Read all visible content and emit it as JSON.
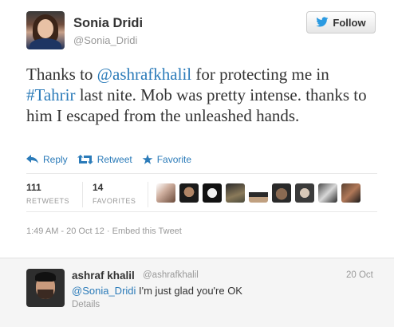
{
  "author": {
    "display_name": "Sonia Dridi",
    "screen_name": "@Sonia_Dridi"
  },
  "follow_button": {
    "label": "Follow",
    "icon": "twitter-bird-icon"
  },
  "tweet": {
    "part1": "Thanks to ",
    "mention": "@ashrafkhalil",
    "part2": " for protecting me in ",
    "hashtag": "#Tahrir",
    "part3": " last nite. Mob was pretty intense. thanks to him I escaped from the unleashed hands."
  },
  "actions": {
    "reply": "Reply",
    "retweet": "Retweet",
    "favorite": "Favorite"
  },
  "stats": {
    "retweets_count": "111",
    "retweets_label": "RETWEETS",
    "favorites_count": "14",
    "favorites_label": "FAVORITES"
  },
  "favoriter_avatars": [
    "avatar-1",
    "avatar-2",
    "avatar-3",
    "avatar-4",
    "avatar-5",
    "avatar-6",
    "avatar-7",
    "avatar-8",
    "avatar-9"
  ],
  "meta": {
    "timestamp": "1:49 AM - 20 Oct 12",
    "separator": " · ",
    "embed": "Embed this Tweet"
  },
  "reply": {
    "display_name": "ashraf khalil",
    "screen_name": "@ashrafkhalil",
    "date": "20 Oct",
    "mention": "@Sonia_Dridi",
    "text": " I'm just glad you're OK",
    "details": "Details"
  },
  "colors": {
    "link": "#2b7bb9",
    "muted": "#999999",
    "text": "#333333",
    "reply_bg": "#f5f5f5"
  }
}
